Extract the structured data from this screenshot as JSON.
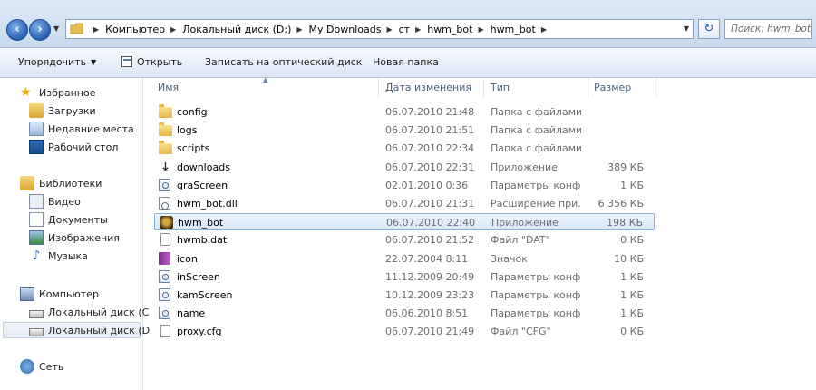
{
  "address": {
    "crumbs": [
      "Компьютер",
      "Локальный диск (D:)",
      "My Downloads",
      "ст",
      "hwm_bot",
      "hwm_bot"
    ]
  },
  "search": {
    "placeholder": "Поиск: hwm_bot"
  },
  "toolbar": {
    "organize": "Упорядочить",
    "open": "Открыть",
    "burn": "Записать на оптический диск",
    "new_folder": "Новая папка"
  },
  "nav": {
    "favorites": "Избранное",
    "downloads": "Загрузки",
    "recent": "Недавние места",
    "desktop": "Рабочий стол",
    "libraries": "Библиотеки",
    "video": "Видео",
    "documents": "Документы",
    "images": "Изображения",
    "music": "Музыка",
    "computer": "Компьютер",
    "drive_c": "Локальный диск (C",
    "drive_d": "Локальный диск (D",
    "network": "Сеть"
  },
  "columns": {
    "name": "Имя",
    "date": "Дата изменения",
    "type": "Тип",
    "size": "Размер"
  },
  "files": [
    {
      "name": "config",
      "date": "06.07.2010 21:48",
      "type": "Папка с файлами",
      "size": "",
      "icon": "folder-icon"
    },
    {
      "name": "logs",
      "date": "06.07.2010 21:51",
      "type": "Папка с файлами",
      "size": "",
      "icon": "folder-icon"
    },
    {
      "name": "scripts",
      "date": "06.07.2010 22:34",
      "type": "Папка с файлами",
      "size": "",
      "icon": "folder-icon"
    },
    {
      "name": "downloads",
      "date": "06.07.2010 22:31",
      "type": "Приложение",
      "size": "389 КБ",
      "icon": "download-app-icon"
    },
    {
      "name": "graScreen",
      "date": "02.01.2010 0:36",
      "type": "Параметры конф...",
      "size": "1 КБ",
      "icon": "config-file-icon"
    },
    {
      "name": "hwm_bot.dll",
      "date": "06.07.2010 21:31",
      "type": "Расширение при...",
      "size": "6 356 КБ",
      "icon": "dll-file-icon"
    },
    {
      "name": "hwm_bot",
      "date": "06.07.2010 22:40",
      "type": "Приложение",
      "size": "198 КБ",
      "icon": "bot-app-icon"
    },
    {
      "name": "hwmb.dat",
      "date": "06.07.2010 21:52",
      "type": "Файл \"DAT\"",
      "size": "0 КБ",
      "icon": "blank-file-icon"
    },
    {
      "name": "icon",
      "date": "22.07.2004 8:11",
      "type": "Значок",
      "size": "10 КБ",
      "icon": "book-icon"
    },
    {
      "name": "inScreen",
      "date": "11.12.2009 20:49",
      "type": "Параметры конф...",
      "size": "1 КБ",
      "icon": "config-file-icon"
    },
    {
      "name": "kamScreen",
      "date": "10.12.2009 23:23",
      "type": "Параметры конф...",
      "size": "1 КБ",
      "icon": "config-file-icon"
    },
    {
      "name": "name",
      "date": "06.06.2010 8:51",
      "type": "Параметры конф...",
      "size": "1 КБ",
      "icon": "config-file-icon"
    },
    {
      "name": "proxy.cfg",
      "date": "06.07.2010 21:49",
      "type": "Файл \"CFG\"",
      "size": "0 КБ",
      "icon": "blank-file-icon"
    }
  ],
  "selected_file": "hwm_bot"
}
